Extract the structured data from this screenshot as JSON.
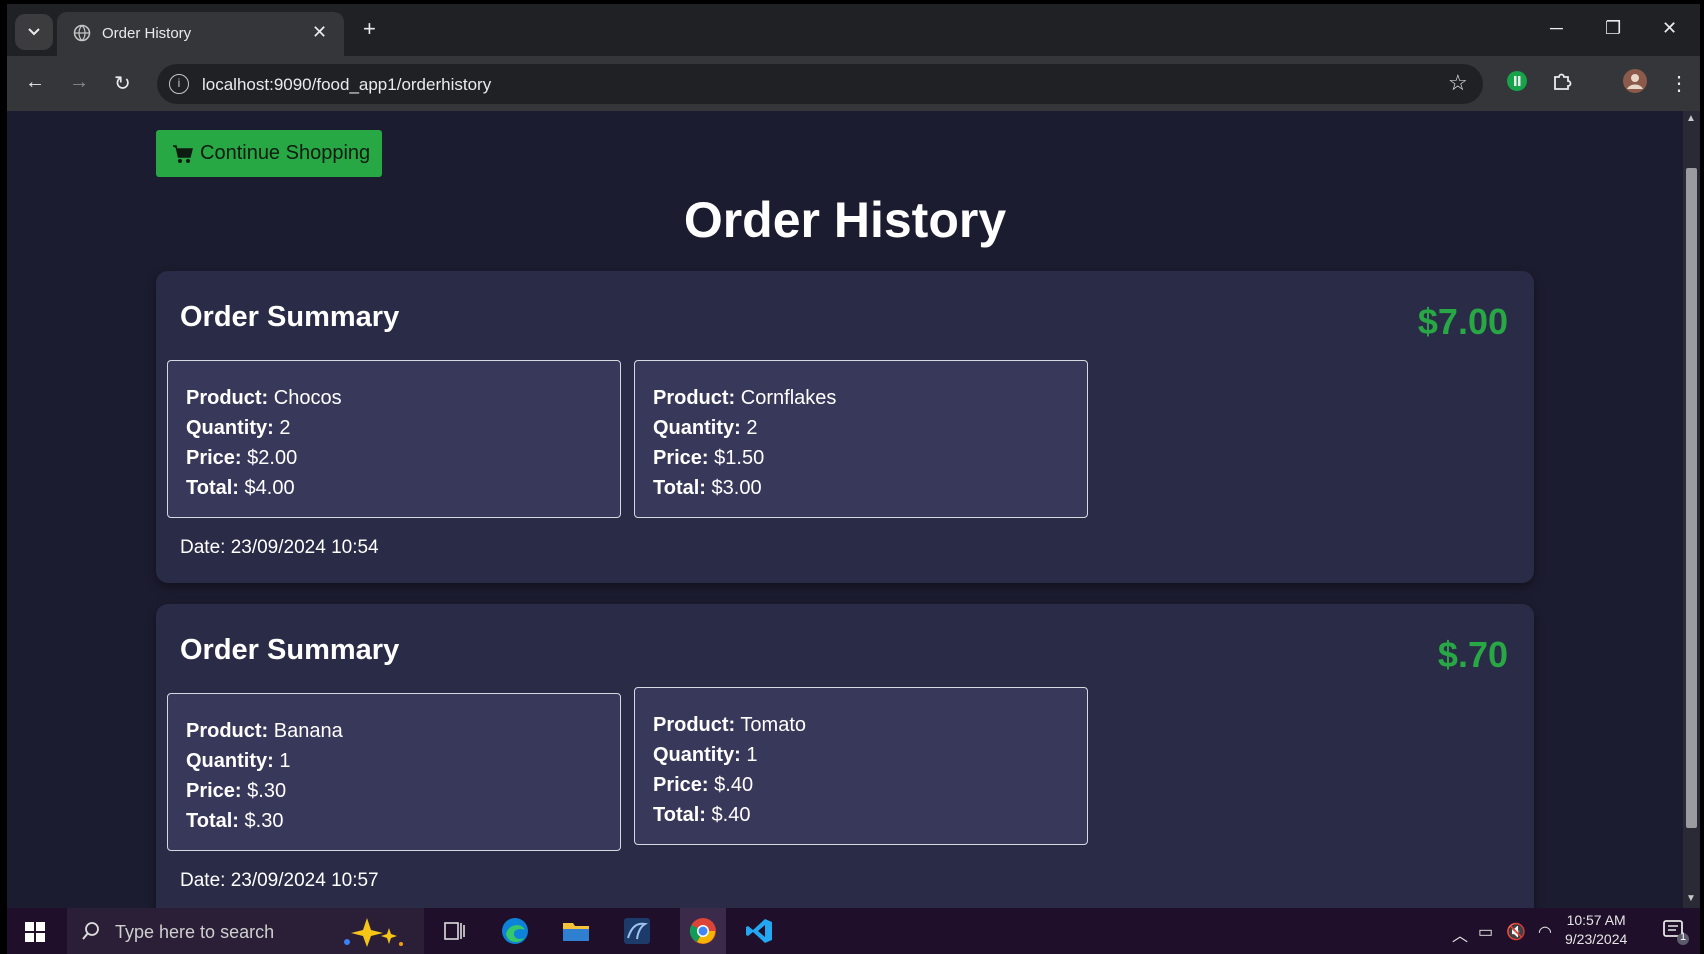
{
  "browser": {
    "tab_title": "Order History",
    "url": "localhost:9090/food_app1/orderhistory"
  },
  "page": {
    "continue_label": "Continue Shopping",
    "title": "Order History",
    "orders": [
      {
        "heading": "Order Summary",
        "total": "$7.00",
        "date": "Date: 23/09/2024 10:54",
        "items": [
          {
            "product": "Chocos",
            "quantity": "2",
            "price": "$2.00",
            "total": "$4.00"
          },
          {
            "product": "Cornflakes",
            "quantity": "2",
            "price": "$1.50",
            "total": "$3.00"
          }
        ]
      },
      {
        "heading": "Order Summary",
        "total": "$.70",
        "date": "Date: 23/09/2024 10:57",
        "items": [
          {
            "product": "Banana",
            "quantity": "1",
            "price": "$.30",
            "total": "$.30"
          },
          {
            "product": "Tomato",
            "quantity": "1",
            "price": "$.40",
            "total": "$.40"
          }
        ]
      }
    ],
    "labels": {
      "product": "Product:",
      "quantity": "Quantity:",
      "price": "Price:",
      "total": "Total:"
    }
  },
  "taskbar": {
    "search_placeholder": "Type here to search",
    "time": "10:57 AM",
    "date": "9/23/2024",
    "notification_count": "1"
  },
  "colors": {
    "accent_green": "#28a745",
    "page_bg": "#1c1c30",
    "card_bg": "#2a2b47"
  }
}
